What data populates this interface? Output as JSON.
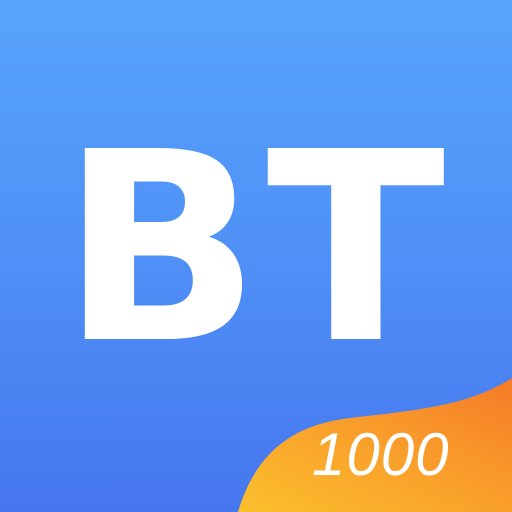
{
  "icon": {
    "logo_text": "BT",
    "badge_text": "1000",
    "colors": {
      "background_top": "#57a4fd",
      "background_bottom": "#4676ee",
      "ribbon_start": "#fbb92a",
      "ribbon_end": "#f77f26",
      "text": "#ffffff"
    }
  }
}
